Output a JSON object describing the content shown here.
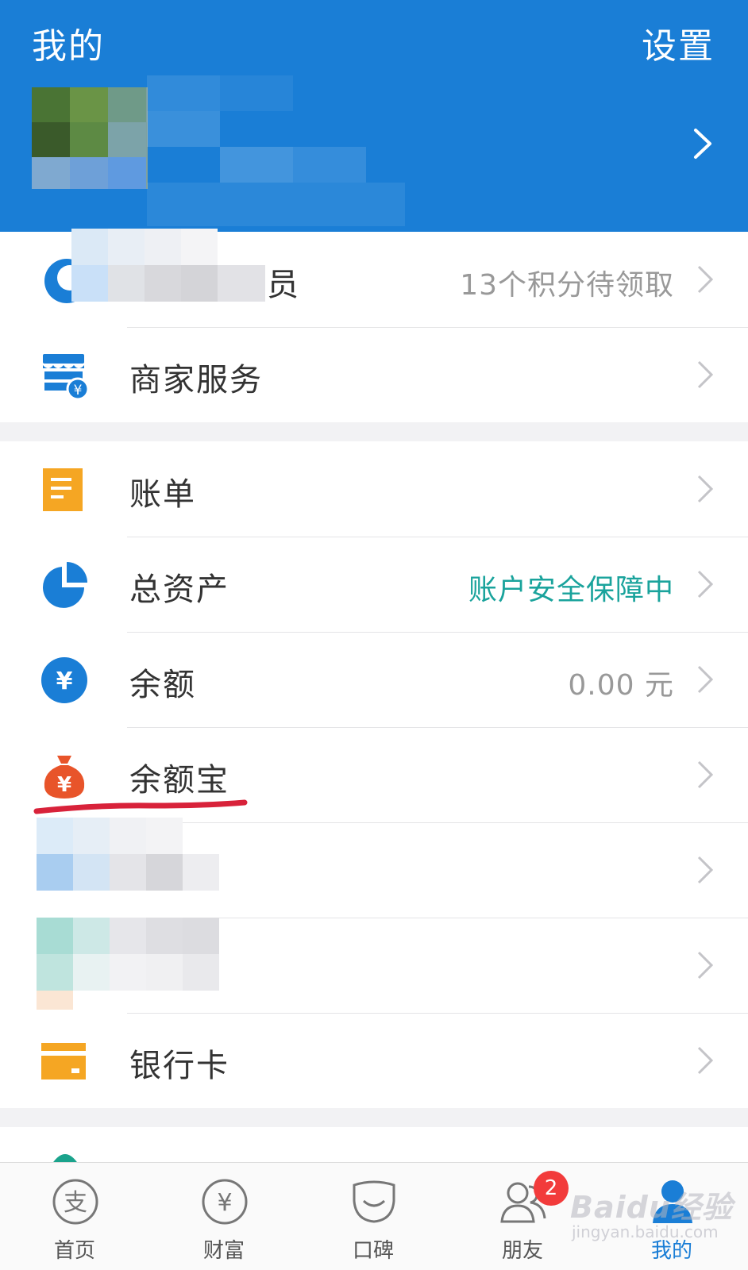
{
  "header": {
    "title": "我的",
    "settings_label": "设置"
  },
  "menu": {
    "member_tail_char": "员",
    "member_points": "13个积分待领取",
    "merchant_label": "商家服务",
    "bill_label": "账单",
    "assets_label": "总资产",
    "assets_status": "账户安全保障中",
    "balance_label": "余额",
    "balance_value": "0.00 元",
    "yuebao_label": "余额宝",
    "bankcard_label": "银行卡"
  },
  "tabs": [
    {
      "label": "首页"
    },
    {
      "label": "财富"
    },
    {
      "label": "口碑"
    },
    {
      "label": "朋友",
      "badge": "2"
    },
    {
      "label": "我的"
    }
  ],
  "watermark": {
    "brand": "Baidu经验",
    "url": "jingyan.baidu.com"
  },
  "colors": {
    "brand_blue": "#1a7ed6",
    "safe_green": "#1aa39c",
    "badge_red": "#f23b3b",
    "bill_orange": "#f5a623",
    "yuebao_red": "#e8542a",
    "underline_red": "#d8223a"
  }
}
